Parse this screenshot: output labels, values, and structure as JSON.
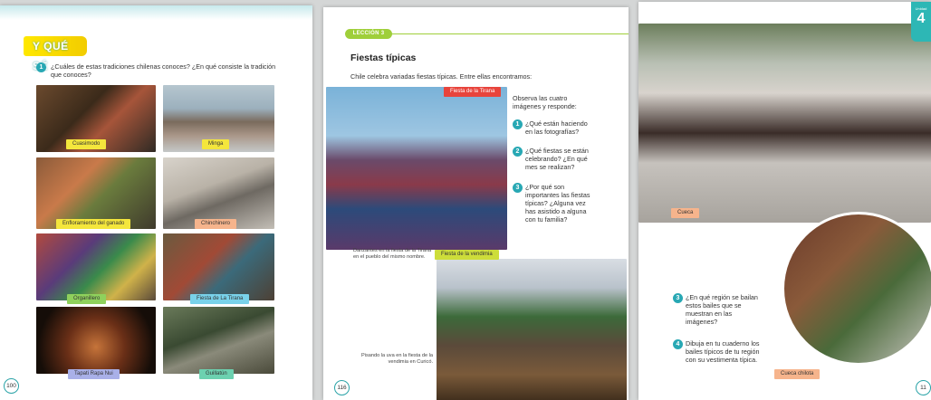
{
  "left_page": {
    "ribbon": "Y QUÉ SÉ",
    "q1_num": "1",
    "q1_text": "¿Cuáles de estas tradiciones chilenas conoces? ¿En qué consiste la tradición que conoces?",
    "photo_labels": [
      "Cuasimodo",
      "Minga",
      "Enfloramiento del ganado",
      "Chinchinero",
      "Organillero",
      "Fiesta de La Tirana",
      "Tapati Rapa Nui",
      "Guillatún"
    ],
    "tag_colors": [
      "#f4e63c",
      "#f4e63c",
      "#f4e63c",
      "#f6b48c",
      "#8fd15c",
      "#79d2ea",
      "#a9b0e8",
      "#6cd1b0"
    ],
    "page_number": "100"
  },
  "middle_page": {
    "lesson": "LECCIÓN 3",
    "title": "Fiestas típicas",
    "intro": "Chile celebra variadas fiestas típicas. Entre ellas encontramos:",
    "tag_tirana": "Fiesta de la Tirana",
    "tag_vendimia": "Fiesta de la vendimia",
    "observe": "Observa las cuatro imágenes y responde:",
    "questions": [
      {
        "n": "1",
        "t": "¿Qué están haciendo en las fotografías?"
      },
      {
        "n": "2",
        "t": "¿Qué fiestas se están celebrando? ¿En qué mes se realizan?"
      },
      {
        "n": "3",
        "t": "¿Por qué son importantes las fiestas típicas? ¿Alguna vez has asistido a alguna con tu familia?"
      }
    ],
    "caption_tirana": "Danzantes en la fiesta de la Tirana en el pueblo del mismo nombre.",
    "caption_vendimia": "Pisando la uva en la fiesta de la vendimia en Curicó.",
    "page_number": "116"
  },
  "right_page": {
    "unit_label": "Unidad",
    "unit_number": "4",
    "tag_cueca": "Cueca",
    "tag_chilota": "Cueca chilota",
    "questions": [
      {
        "n": "3",
        "t": "¿En qué región se bailan estos bailes que se muestran en las imágenes?"
      },
      {
        "n": "4",
        "t": "Dibuja en tu cuaderno los bailes típicos de tu región con su vestimenta típica."
      }
    ],
    "page_number": "11"
  },
  "colors": {
    "accent": "#28a8b4",
    "lesson": "#9fcf3a",
    "ribbon": "#ffe800",
    "red_tag": "#e8443c"
  }
}
